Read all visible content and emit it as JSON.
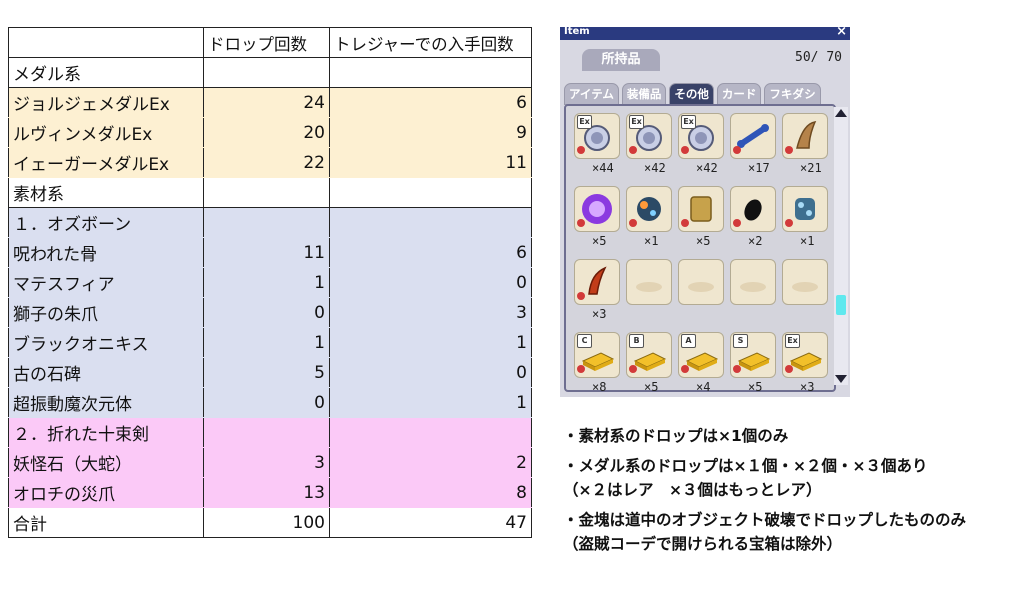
{
  "table": {
    "headers": [
      "",
      "ドロップ回数",
      "トレジャーでの入手回数"
    ],
    "rows": [
      {
        "label": "メダル系",
        "drop": "",
        "treasure": "",
        "style": "plain"
      },
      {
        "label": "ジョルジェメダルEx",
        "drop": "24",
        "treasure": "6",
        "style": "hl-medal"
      },
      {
        "label": "ルヴィンメダルEx",
        "drop": "20",
        "treasure": "9",
        "style": "hl-medal"
      },
      {
        "label": "イェーガーメダルEx",
        "drop": "22",
        "treasure": "11",
        "style": "hl-medal"
      },
      {
        "label": "素材系",
        "drop": "",
        "treasure": "",
        "style": "plain"
      },
      {
        "label": "１．オズボーン",
        "drop": "",
        "treasure": "",
        "style": "hl-blue"
      },
      {
        "label": "呪われた骨",
        "drop": "11",
        "treasure": "6",
        "style": "hl-blue"
      },
      {
        "label": "マテスフィア",
        "drop": "1",
        "treasure": "0",
        "style": "hl-blue"
      },
      {
        "label": "獅子の朱爪",
        "drop": "0",
        "treasure": "3",
        "style": "hl-blue"
      },
      {
        "label": "ブラックオニキス",
        "drop": "1",
        "treasure": "1",
        "style": "hl-blue"
      },
      {
        "label": "古の石碑",
        "drop": "5",
        "treasure": "0",
        "style": "hl-blue"
      },
      {
        "label": "超振動魔次元体",
        "drop": "0",
        "treasure": "1",
        "style": "hl-blue"
      },
      {
        "label": "２．折れた十束剣",
        "drop": "",
        "treasure": "",
        "style": "hl-pink"
      },
      {
        "label": "妖怪石（大蛇）",
        "drop": "3",
        "treasure": "2",
        "style": "hl-pink"
      },
      {
        "label": "オロチの災爪",
        "drop": "13",
        "treasure": "8",
        "style": "hl-pink"
      },
      {
        "label": "合計",
        "drop": "100",
        "treasure": "47",
        "style": "plain"
      }
    ]
  },
  "inventory": {
    "title": "Item",
    "close": "×",
    "owned_tab": "所持品",
    "capacity": "50/ 70",
    "tabs": [
      {
        "label": "アイテム",
        "active": false
      },
      {
        "label": "装備品",
        "active": false
      },
      {
        "label": "その他",
        "active": true
      },
      {
        "label": "カード",
        "active": false
      },
      {
        "label": "フキダシ",
        "active": false
      }
    ],
    "slots": [
      {
        "icon": "medal-ex-icon",
        "badge": "Ex",
        "qty": "×44"
      },
      {
        "icon": "medal-ex-icon",
        "badge": "Ex",
        "qty": "×42"
      },
      {
        "icon": "medal-ex-icon",
        "badge": "Ex",
        "qty": "×42"
      },
      {
        "icon": "bone-icon",
        "badge": "",
        "qty": "×17"
      },
      {
        "icon": "claw-icon",
        "badge": "",
        "qty": "×21"
      },
      {
        "icon": "purple-orb-icon",
        "badge": "",
        "qty": "×5"
      },
      {
        "icon": "sphere-icon",
        "badge": "",
        "qty": "×1"
      },
      {
        "icon": "stone-tablet-icon",
        "badge": "",
        "qty": "×5"
      },
      {
        "icon": "black-onyx-icon",
        "badge": "",
        "qty": "×2"
      },
      {
        "icon": "crystal-icon",
        "badge": "",
        "qty": "×1"
      },
      {
        "icon": "red-fang-icon",
        "badge": "",
        "qty": "×3"
      },
      {
        "icon": "",
        "badge": "",
        "qty": ""
      },
      {
        "icon": "",
        "badge": "",
        "qty": ""
      },
      {
        "icon": "",
        "badge": "",
        "qty": ""
      },
      {
        "icon": "",
        "badge": "",
        "qty": ""
      },
      {
        "icon": "gold-bar-icon",
        "badge": "C",
        "qty": "×8"
      },
      {
        "icon": "gold-bar-icon",
        "badge": "B",
        "qty": "×5"
      },
      {
        "icon": "gold-bar-icon",
        "badge": "A",
        "qty": "×4"
      },
      {
        "icon": "gold-bar-icon",
        "badge": "S",
        "qty": "×5"
      },
      {
        "icon": "gold-bar-icon",
        "badge": "Ex",
        "qty": "×3"
      }
    ],
    "scrollbar_position": 0.75
  },
  "notes": [
    "・素材系のドロップは×1個のみ",
    "・メダル系のドロップは×１個・×２個・×３個あり",
    "（×２はレア　×３個はもっとレア）",
    "・金塊は道中のオブジェクト破壊でドロップしたもののみ",
    "（盗賊コーデで開けられる宝箱は除外）"
  ]
}
